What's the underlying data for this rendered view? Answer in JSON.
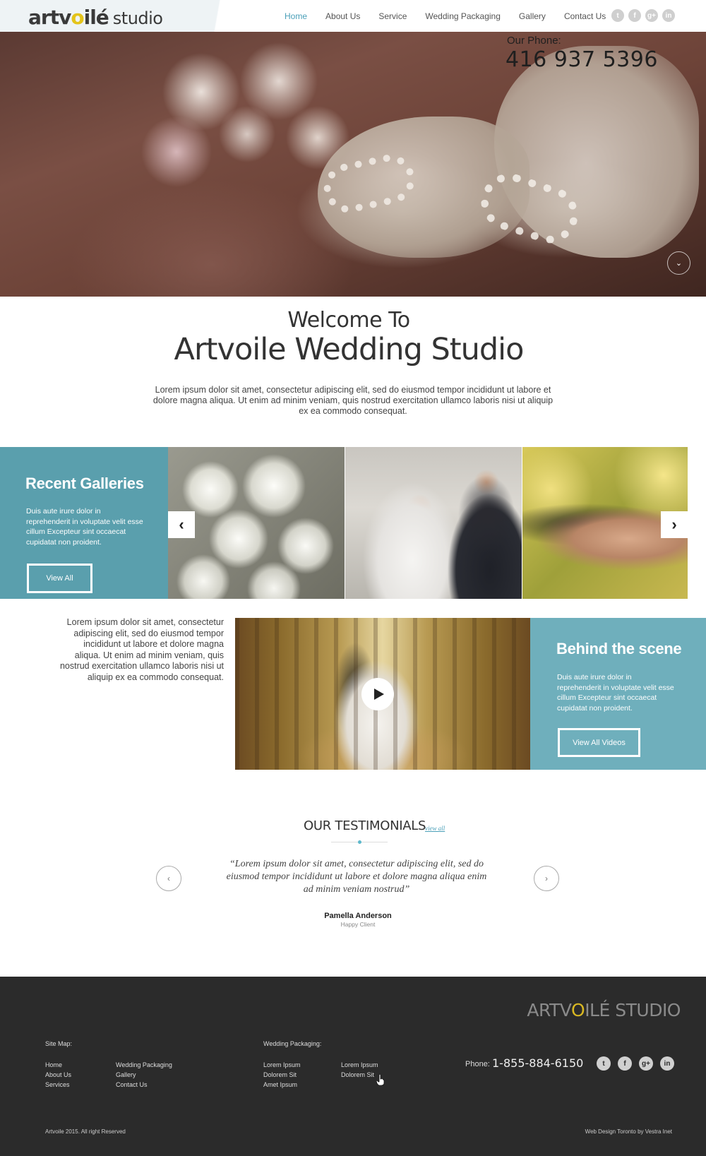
{
  "header": {
    "logo_main_1": "artv",
    "logo_main_o": "o",
    "logo_main_2": "ilé",
    "logo_sub": "studio",
    "nav": [
      "Home",
      "About Us",
      "Service",
      "Wedding Packaging",
      "Gallery",
      "Contact Us"
    ],
    "active_nav": "Home",
    "social": [
      "twitter-icon",
      "facebook-icon",
      "google-plus-icon",
      "linkedin-icon"
    ]
  },
  "hero": {
    "phone_label": "Our Phone:",
    "phone_number": "416 937 5396",
    "scroll_icon": "chevron-down-icon"
  },
  "welcome": {
    "line1": "Welcome To",
    "line2": "Artvoile Wedding Studio",
    "text": "Lorem ipsum dolor sit amet, consectetur adipiscing elit, sed do eiusmod tempor incididunt ut labore et dolore magna aliqua. Ut enim ad minim veniam, quis nostrud exercitation ullamco laboris nisi ut aliquip ex ea commodo consequat."
  },
  "galleries": {
    "title": "Recent Galleries",
    "text": "Duis aute irure dolor in reprehenderit in voluptate velit esse cillum Excepteur sint occaecat cupidatat non proident.",
    "button": "View All",
    "prev_icon": "chevron-left-icon",
    "next_icon": "chevron-right-icon"
  },
  "behind": {
    "side_text": "Lorem ipsum dolor sit amet, consectetur adipiscing elit, sed do eiusmod tempor incididunt ut labore et dolore magna aliqua. Ut enim ad minim veniam, quis nostrud exercitation ullamco laboris nisi ut aliquip ex ea commodo consequat.",
    "title": "Behind the scene",
    "text": "Duis aute irure dolor in reprehenderit in voluptate velit esse cillum Excepteur sint occaecat cupidatat non proident.",
    "button": "View All Videos",
    "play_icon": "play-icon"
  },
  "testimonials": {
    "title": "OUR TESTIMONIALS",
    "view_all": "view all",
    "quote": "“Lorem ipsum dolor sit amet, consectetur adipiscing elit, sed do eiusmod tempor incididunt ut labore et dolore magna aliqua enim ad minim veniam nostrud”",
    "name": "Pamella Anderson",
    "role": "Happy Client"
  },
  "footer": {
    "logo_1": "ARTV",
    "logo_o": "O",
    "logo_2": "ILÉ",
    "logo_3": "STUDIO",
    "sitemap_title": "Site Map:",
    "sitemap_col1": [
      "Home",
      "About Us",
      "Services"
    ],
    "sitemap_col2": [
      "Wedding Packaging",
      "Gallery",
      "Contact Us"
    ],
    "packaging_title": "Wedding Packaging:",
    "packaging_col1": [
      "Lorem Ipsum",
      "Dolorem Sit",
      "Amet Ipsum"
    ],
    "packaging_col2": [
      "Lorem Ipsum",
      "Dolorem Sit"
    ],
    "phone_label": "Phone:",
    "phone_number": "1-855-884-6150",
    "social": [
      "twitter-icon",
      "facebook-icon",
      "google-plus-icon",
      "linkedin-icon"
    ],
    "copyright": "Artvoile 2015. All right Reserved",
    "credit": "Web Design Toronto by Vestra Inet"
  },
  "colors": {
    "accent_dark_teal": "#5a9fad",
    "accent_light_teal": "#6fafbc",
    "nav_active": "#4a9fb8",
    "footer_bg": "#2b2b2b",
    "logo_gold": "#e4c41a"
  }
}
